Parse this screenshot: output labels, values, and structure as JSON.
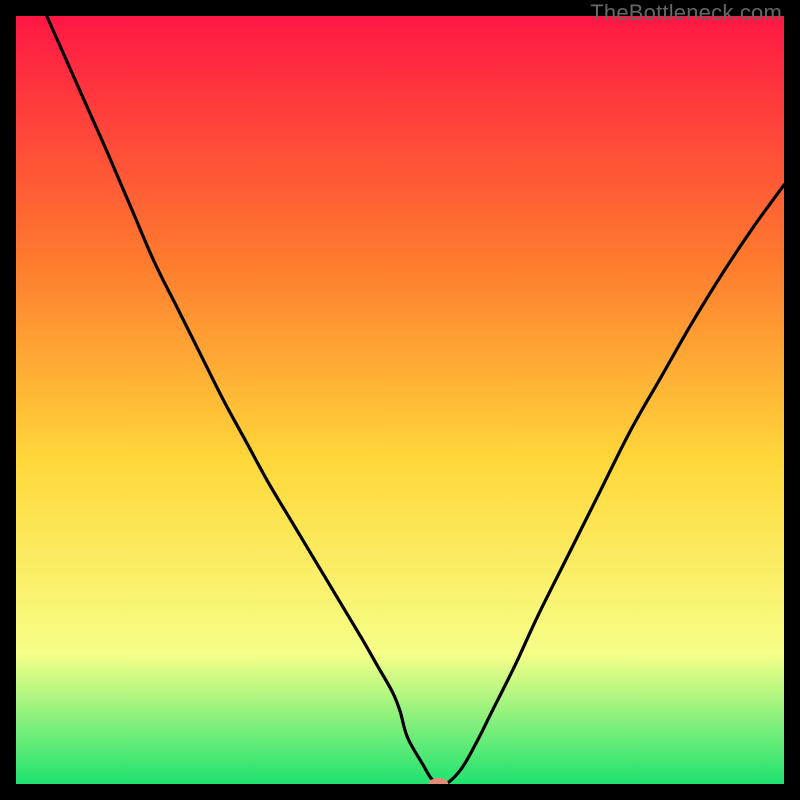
{
  "watermark": "TheBottleneck.com",
  "chart_data": {
    "type": "line",
    "title": "",
    "xlabel": "",
    "ylabel": "",
    "xlim": [
      0,
      100
    ],
    "ylim": [
      0,
      100
    ],
    "background_gradient": {
      "top": "#FF1744",
      "upper_mid": "#FF7B2E",
      "mid": "#FFD83A",
      "lower_mid": "#F6FF88",
      "bottom": "#1FE270"
    },
    "series": [
      {
        "name": "bottleneck-curve",
        "color": "#000000",
        "x": [
          4,
          6,
          8,
          10,
          12,
          15,
          18,
          21,
          24,
          27,
          30,
          33,
          36,
          39,
          42,
          45,
          47,
          49,
          50,
          51,
          53,
          54,
          55,
          56,
          58,
          60,
          62,
          65,
          68,
          72,
          76,
          80,
          84,
          88,
          92,
          96,
          100
        ],
        "y": [
          100,
          95.5,
          91,
          86.5,
          82,
          75,
          68,
          62,
          56,
          50,
          44.5,
          39,
          34,
          29,
          24,
          19,
          15.5,
          12,
          9.5,
          6,
          2.5,
          0.8,
          0,
          0,
          2,
          5.5,
          9.5,
          15.5,
          22,
          30,
          38,
          46,
          53,
          60,
          66.5,
          72.5,
          78
        ]
      }
    ],
    "marker": {
      "name": "optimal-point",
      "x": 55,
      "y": 0,
      "color": "#E58A7B",
      "rx": 10,
      "ry": 6
    }
  }
}
